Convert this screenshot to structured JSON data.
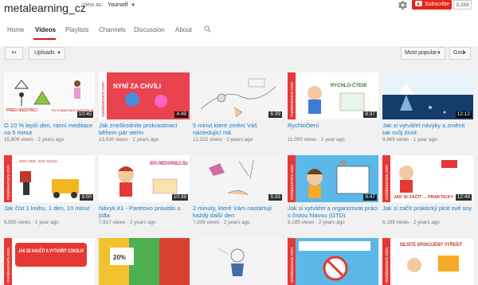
{
  "channel": {
    "name": "metalearning_cz",
    "view_as_label": "View as:",
    "view_as_value": "Yourself",
    "subscribe_label": "Subscribe",
    "subscriber_count": "3,289"
  },
  "tabs": [
    {
      "label": "Home"
    },
    {
      "label": "Videos"
    },
    {
      "label": "Playlists"
    },
    {
      "label": "Channels"
    },
    {
      "label": "Discussion"
    },
    {
      "label": "About"
    }
  ],
  "toolbar": {
    "uploads_label": "Uploads",
    "sort_label": "Most popular",
    "view_label": "Grid"
  },
  "colors": {
    "accent": "#cc181e",
    "link": "#167ac6",
    "subscribe_red": "#e62117"
  },
  "videos": [
    {
      "title": "O 10 % lepší den, ranní meditace na 5 minut",
      "views": "15,909 views",
      "age": "2 years ago",
      "duration": "10:45"
    },
    {
      "title": "Jak zneškodnite prokrastinaci během pár vteřin",
      "views": "13,030 views",
      "age": "2 years ago",
      "duration": "4:49"
    },
    {
      "title": "5 minut které změní Váš následující rok",
      "views": "12,322 views",
      "age": "2 years ago",
      "duration": "6:39"
    },
    {
      "title": "Rychločtení",
      "views": "11,000 views",
      "age": "1 year ago",
      "duration": "8:37"
    },
    {
      "title": "Jak si vytvářet návyky a změnit tak svůj život",
      "views": "9,969 views",
      "age": "1 year ago",
      "duration": "12:12"
    },
    {
      "title": "Jak číst 1 knihu, 1 den, 10 minut",
      "views": "8,855 views",
      "age": "1 year ago",
      "duration": "9:00"
    },
    {
      "title": "Návyk #1 - Paretovo pravidlo u jídla",
      "views": "7,617 views",
      "age": "2 years ago",
      "duration": "10:39"
    },
    {
      "title": "2 minuty, které Vám nastartují každý další den",
      "views": "7,009 views",
      "age": "2 years ago",
      "duration": "5:33"
    },
    {
      "title": "Jak si vytvářet a organizovat práci s čistou hlavou (GTD)",
      "views": "6,185 views",
      "age": "2 years ago",
      "duration": "9:47"
    },
    {
      "title": "Jak si začít praktický plnit své sny",
      "views": "6,189 views",
      "age": "2 years ago",
      "duration": "12:49"
    },
    {
      "title": "",
      "views": "",
      "age": "",
      "duration": ""
    },
    {
      "title": "",
      "views": "",
      "age": "",
      "duration": ""
    },
    {
      "title": "",
      "views": "",
      "age": "",
      "duration": ""
    },
    {
      "title": "",
      "views": "",
      "age": "",
      "duration": ""
    },
    {
      "title": "",
      "views": "",
      "age": "",
      "duration": ""
    }
  ],
  "thumbnails": {
    "t1_top": "PRED MEDITACI",
    "t1_bot": "PO 5 MINUTACH MEDITACE",
    "t2_text": "NYNÍ ZA CHVÍLI",
    "t4_text": "RYCHLO-ČTENÍ",
    "t6_text": "... SOO ONE, SOO MUCH ...",
    "t7_text": "NÁVYK 1 PARETOVO PRAVIDLO U JÍDLA",
    "t10_text": "JAK SI ZAČÍT ... PRAKTICKY",
    "t11_text": "JAK SE NAUČIT A VYTVOŘIT COKOLIV",
    "t12_text": "20%",
    "t15_text": "NEJSTE SPOKOJENI? VYŘEŠIT",
    "brand": "metalearners.com"
  }
}
